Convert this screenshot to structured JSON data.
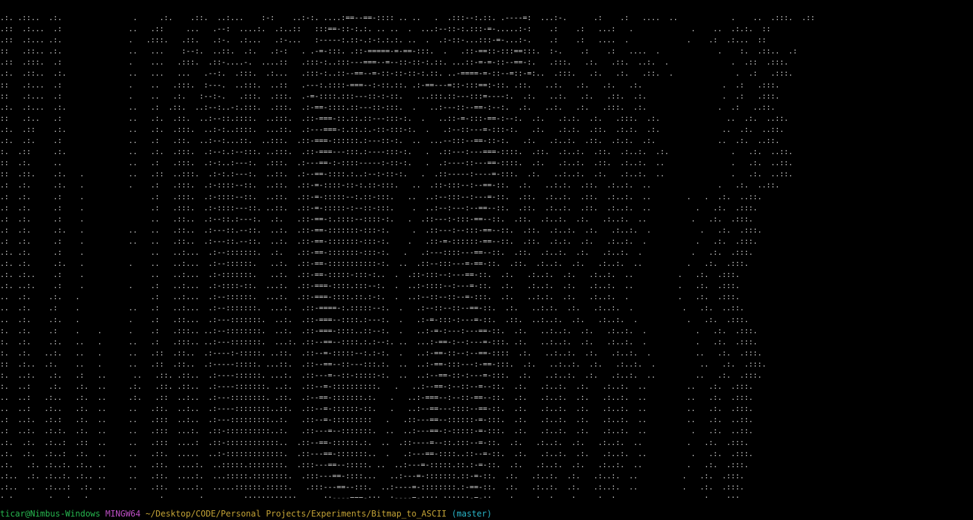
{
  "terminal": {
    "ascii_output": [
      ".:. .::..  .:.                .     .:.    .::.  ..:...    :-:    ..:-:. ....:==--==-:::: .. ..   .  .:::--:.::. .----=:  ...:-.      .:    .:   ....  ..            .    ..  .:::.  .::",
      ".::  .:...  .:               ..   .::     ...   .--:  ....:.  .:..::   :::==-::-:.:. .. ..  .  ...:--::-:.:::-=-.....:-:    .:    .:   ...:   .             .    ..  .:.:.  ::",
      ".::  .:... .:.               .   .:::.   .::.   .:-.  .:...   .:-...   :-----:.::-.:-:.:.:. ..  .  .:-::-...:::-=-...:-.    .:    .:   ....  .             .    .:  .:...  ::",
      "::   .::.. .:.               ..   ...    :--:.  ..::.  .:.   .:-:   . .-=-:::. .::-=====-=-==-:::.  .   .::-==::-:::==:::.  :-.    .:    .:   ....  .             .    :.  .::..  .:",
      ".::  .:::.  .:               .    ...   .:::.  .::-....-.  ....::   .:::-:..:::---===--=--::-::-:.::. ...::-=-=-::--==-:.   .:::.   .:.   .::.  ..:.  .              .  .::  .:::.",
      ".:.  .::..  .:.              ..   ...   ...   .--:.  .:::.  .:...   .:::-:..::--==--=-::-::-::-:.::. ..-====-=-::--=::-=:..  .:::.   .:.   .:.   .::.  .              .  .:   .:::.",
      "::   .:...  .:               .    ..   .:::.  :---.  ..:::.  ..::   .---:.::::-===--:-::.::. .:-==---=::-:::==:-::. .::.   ..:.   .:.   .:.   .:.                  .  .:   .:::.",
      "::   .:...  .:               .    ..   .:.   :--:-.   .:::.  .:::.  .-=-::::.:::---::-:-::.   ...:::.::---:::=----:.  .:.   ..:.   .:.   .::.  .:.                 .  .:   .:::.",
      ".:.  .:...  .:.              ..   .:  .::.  ..:--:..-:.:::.  .:::.  .:-==-::::.::---::-:::.  .   ..:---::--==-:--:.  .:.   ..:.   .:.   .:::.  .:.                .  .:   ..::.",
      "::   .:..   .:               ..   .:.  .::.  ..:--::.::::.  ..:::.  .::-===-::.::.::---:::-:.  .   ..::-=-:::-==-:--:.  .:.   .:.:.  .:.   .:::.  .:.               ..  .:.  ..::.",
      ".:.  .::    .:.              ..   .:.  .:::.  ..:-:..::::.  ...::.  .:---===-:.::.:.-::-:::-:.  .   .:--::---=-:::-:.   .:.   .:.:.  .::.  .:.:.  .:.              ..  .:.  ..::.",
      ".:.  .:.    .:               ..   .:   .::.  ..:--:...::.  ..:::.  .::-===-::::::.:---::-:.  ..  ...--:::--==-::-:.   .:.   .:..:.  .::.  .:.:.  .:.              ..  .:.  ..::.",
      ":.  .::     .:.              ..   .:.  .:::.  .:--:.:--:::. ..:::.  .::-===---:::.:----:::-:.   .  .::---:---===-::::.  .::.  .:..:.  .::.  .:..:.  .:.              .   .:.  ..::.",
      "::  .:.     ..               ..   .:   .:::.  .:-:..:---:.  .:::.  .:---==-:-::::-----:-::-:.   .  .:----::---==-::::.  .:.   .:..:.  .::.  .:..:.  ..               .   .:.  ..::.",
      "::  .::.    .:.   .          ..   .::  ..:::.  .:-:.:---:.  ..::.  .:--==-::::.:..:--:-::-:.   .  .::-----:----=-:::.  .:.   ..:..:.  .:.   .:..:.  ..               .   .:.  ..::.",
      ".:  .:.     .:.   .          .    .:   .:::.  .:-::::--::.  ..::.  .::-=-::::-::-:.::-:::.   ..  .::-:::--:--==-::.  .:.   ..:.:.  .::.  .:..:.  ..               .   .:.  ..::.",
      ".:  .:.     .:    .               .:   .:::.  .:-::::--::.  ..::.  .::-=-:::::--:.::-:::.   ..  ..:--:::--:---=-::.  .::.  .:..:.  .::.  .:..:.  ..        .   .  .:.  ..::.",
      ".:  .:.     .:    .               .:   .:::.  .:-::::---::. ..::.  .::-=-:::::-:--::-:::.    .  ..:--:---:--==--::.  .::.  .:..:.  .::.  .:..:.  ..          .   .:.  .:::.",
      ".:  .:.     .:    .               ..   .::..  .:--::.:---:.  .:.   .::-==-:.::::--::::-:.   .  .::---:-:::-==--::.  .::.  .:..:.  .:.   .:..:.  ..          .   .:.  .:::.",
      ".:  .:.     .:.   .          ..   ..   .::..  .:---::.--::.  ..:.  .::-==-:::::::-:::-:.     .  .::---:--:::-==--::.  .::.  .:..:.  .:.   .:..:.  .           .   .:.  .:::.",
      ".:  .:.     .:    .          ..   ..   .::..  .:---::.--::.  ..:.  .::-==-:::::::-:::-:.    .   .::-=-::::::-==--::.  .::.  .:.:.  .:.   .:..:.  .           .   .:.  .:::.",
      ".:. .:.     .:    .               ..   ..:...  .:--:::::::.  .:.   .::-==-:::::::-:::-:.   .   .:---::::---==--::.  .::.  .:..:.  .:.   .:..:.  .           .   .:.  .:::.",
      ".:. .:.     .:.   .          .    ..   ..:...  .:--::::::.   ..:.  .::-==-:::::::::::-:.  ..  .::--:::---=-==-::.  .::.  .:..:.  .:.   .:..:.  ..          .   .:.  .:::.",
      ".:. .:..    .:    .               ..   ..:...  .:-:::::::.   ..:.  .::-==-:::::-:::-:..  .  .::-:::--:---==-::.  .:.   .:..:.  .:.   .:..:.  ..          .   .:.  .:::.",
      ".:. ..:.    .:    .          .    .:   ..:...  .:-::::-::.  ...:.  .::-===-::::.:::--:.  .  ..:-::::--:---=-::.  .:.   .:..:.  .:.   .:..:.  ..          .   .:.  .:::.",
      "..  .:.    .:.   .                .:   ..:...  .:--::::::.  ...:.  .::-===-::::.::.:-:.  .  ..:--::--::--=-:::.  .:.   ..:.:.  .:.   .:..:.  .           .   .:.  .:::.",
      "..  .:.    .:    .           ..   .:   ..:...  .:--:::::::.  ...:.  .::-====-:.:::::--:.  .   .:--::--::--==-::.  .:.   ..:.:.  .:.   .:..:.  .           .   .:.  ..::.",
      "..  .:.    .:.   .           .    .:   .::...  .:---:::::::.  ..:.  .::-===--::::.:---:.  .   .:-=-:::-:---=-::.  .::.  ..:..:.  .:.   .:..:.  .           .   .:.  .:::.",
      ":.  .:.    .:    .    .      .    .:   .:::.. ..:--::::::::.  ..:.  .::-===-::::..::--:.  .   ..:-=-:---:---==-::.  .:.   ..:..:.  .:.   .:..:.  .           .   .:.  .:::.",
      ":.  .:.    .:.   ..   .      ..   .:   .:::.. ..:---:::::::.  ...:. .::--==--::::.:.:--:. ..  ...:-==-:--:---=-:::. .:.   ..:..:.  .:.   .:..:.  .           .   .:.  .:::.",
      ":.  .:.   ..:.   ..   .      ..   .::  .::..  .:----:-:::::. ..::.  .::--=-:::::--:.:-:.  .   ..:-==-::--:--==-::::  .:.   ..:..:.  .:.   .:..:.  .          ..   .:.  .:::.",
      "::  .:..  .:.    ..   .      ..   .::  .::..  .:-----:::::. ...::.  .::--==--::---:::.:.  ..  ..:-==-:::---:-==-:::.  .:.   ..:..:.  .:.   .:..:.  .          ..   .:.  .:::.",
      ":.  ..:.   .:.   .:   ..      ..   .::. .::..  .:----::::::. ...:.  .::---=--::-:::::-:.  ..  ..:--==-::-:---=-:::.  .:.   ..:..:.  .:.   .:..:.  ..         ..   .:.  .:::.",
      ":.  ..:    .:.   .:.  ..     .:.   .::. .::..  .:----:::::::. ..:.  .::--=-::::::::::.   .   ..:--==-:--::--=--::.  .:.   .:..:.  .:.   .:..:.  ..         ..   .:.  .:::.",
      "..  ..:   .:..   .:.  ..     .:.   .::  ..:..  .:---::::::::. .::.  .:--==-:::::::.:.   .   ..:-===--:--::-==--::.  .:.   .:..:.  .:.   .:..:.  ..         ..   .:.  .:::.",
      "..  ..:   .:..   .:.  ..     ..   .::.  ..:..  .:----::::::::..::.  .::--=-::::::-::.   .   ..:--==---::::--==-::.  .:.   .:..:.  .:.   .:..:.  ..         ..   .:.  .:::.",
      ".:  ..:.  .:.:   .:.  ..     ..   .:::  ..:..  .:---:::::::::..:.   .::--=-:::::::::   .   .::---==--::::::-=-:::.  .:.   .:..:.  .:.   .:..:.  ..         ..   .:.  ..::.",
      ".:  ..:.  .:.:.  .:.  ..     ..   .:::  ...:.  .::-::::::::::..:.   .::---=--:::::::.  ..  ..:---==-:-:::::-=-:::.  .:.   .:..:.  .:.   .:..:.  ..          .   .:.  ..::.",
      ".:.  .:.  .:..:  .::  ..     ..   .:::  ....:  .::-::::::::::::..  .::--==-::::::.:.  ..  .::----=--::.:::--=-::.  .:.   .:..:.  .:.   .:..:.  ..          .   .:.  .:::.",
      ".:.  .:.  .:..:  .:.  ..     ..   .::.  .....  ..:-:::::::::::::.  .::---==-:::::::..  .   .:---==-::::..::--=-::.  .:.   .:..:.  .:.   .:..:.  ..          .   .:.  .:::.",
      ".:.   .:. .:..:. .:.. ..     ..   .::.  ....:.  ..:::::.::::::::.  .:::---==--:::::. ..  ..:---=-:::::.::.:-=-::.  .:.   .:..:.  .:.   .:..:.  ..          .   .:.  .:::.",
      ".:..  .:. .:..:. .:.. ..     ..   .::.  ....:.  ...:::::.::::::::.  .:::---==-::::...   ..:---=-:::::::.::-=-::.  .:.   .:..:.  .:.   .:..:.  ..          .   .:.  .:::.",
      ".:..  ..  .:...:  .:. ..     ..   .::.  ....:.  .....::::::.:::::.   .:::---==--:::.  ..:----=-::::::::.:-==-::.  .:.   .:..:.  .:.   .:..:.  ..          .   .:.  .:::.",
      ":.:.  ..  .:...:  .:. ..     ..   ..:.  .....:.  ......::::::::::::.   ..::----===-:::..:----=-::::.::::::-=-::.  .:.   .:..:.  .:.   .:..:.  ..          .   .:.  .:::."
    ],
    "prompt": {
      "user_host": "ticar@Nimbus-Windows",
      "shell": "MINGW64",
      "cwd": "~/Desktop/CODE/Personal Projects/Experiments/Bitmap_to_ASCII",
      "branch": "(master)"
    },
    "colors": {
      "background": "#000000",
      "text": "#d6d6d6",
      "user_host": "#26b74f",
      "shell": "#c050c8",
      "cwd": "#c5a436",
      "branch": "#29b6c9"
    }
  }
}
